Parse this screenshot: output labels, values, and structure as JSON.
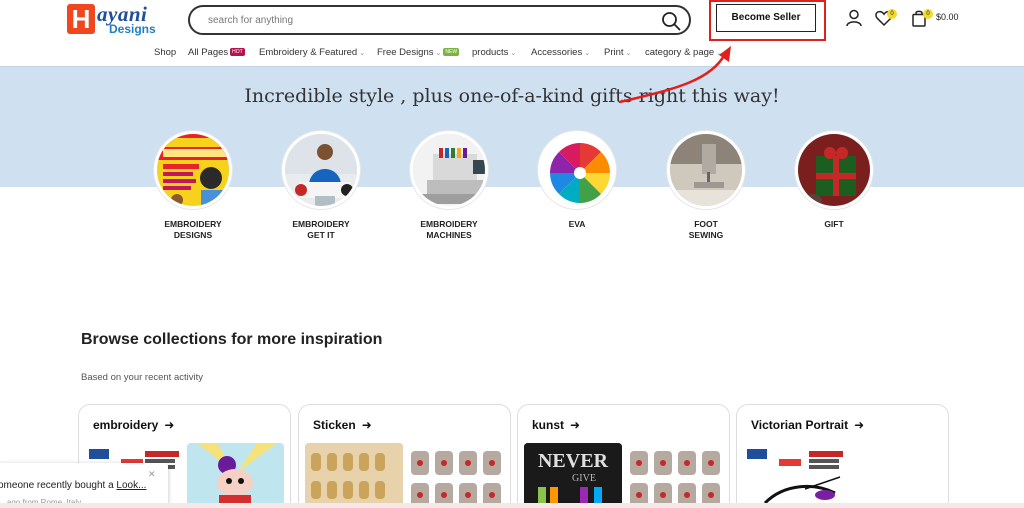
{
  "header": {
    "logo": {
      "mark": "H",
      "word1": "ayani",
      "word2": "Designs"
    },
    "search_placeholder": "search for anything",
    "become_seller": "Become Seller",
    "wishlist_count": "0",
    "cart_count": "0",
    "cart_total": "$0.00"
  },
  "nav": [
    {
      "label": "Shop"
    },
    {
      "label": "All Pages",
      "tag": "HOT"
    },
    {
      "label": "Embroidery & Featured"
    },
    {
      "label": "Free Designs",
      "tag": "NEW"
    },
    {
      "label": "products"
    },
    {
      "label": "Accessories"
    },
    {
      "label": "Print"
    },
    {
      "label": "category & page"
    }
  ],
  "banner": {
    "title": "Incredible style , plus one-of-a-kind gifts right this way!"
  },
  "categories": [
    {
      "line1": "EMBROIDERY",
      "line2": "DESIGNS"
    },
    {
      "line1": "EMBROIDERY",
      "line2": "GET IT"
    },
    {
      "line1": "EMBROIDERY",
      "line2": "MACHINES"
    },
    {
      "line1": "EVA",
      "line2": ""
    },
    {
      "line1": "FOOT",
      "line2": "SEWING"
    },
    {
      "line1": "GIFT",
      "line2": ""
    }
  ],
  "browse": {
    "title": "Browse collections for more inspiration",
    "subtitle": "Based on your recent activity",
    "collections": [
      {
        "title": "embroidery"
      },
      {
        "title": "Sticken"
      },
      {
        "title": "kunst"
      },
      {
        "title": "Victorian Portrait"
      }
    ]
  },
  "toast": {
    "text_prefix": "omeone recently bought a ",
    "text_link": "Look...",
    "sub": "... ago from Rome, Italy"
  },
  "colors": {
    "accent_red": "#e0201d",
    "banner_bg": "#cfe0f1",
    "badge": "#f3d92a"
  }
}
